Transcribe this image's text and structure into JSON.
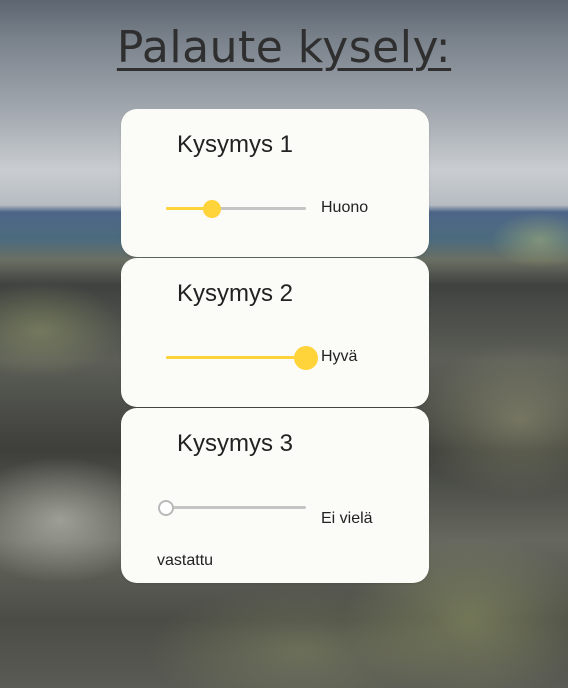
{
  "page": {
    "title": "Palaute kysely:"
  },
  "questions": [
    {
      "title": "Kysymys 1",
      "answer": "Huono",
      "slider_value": 0.33
    },
    {
      "title": "Kysymys 2",
      "answer": "Hyvä",
      "slider_value": 1.0
    },
    {
      "title": "Kysymys 3",
      "answer": "Ei vielä vastattu",
      "slider_value": 0.0
    }
  ],
  "colors": {
    "accent": "#ffd43b",
    "track": "#c4c4c4",
    "card": "#fbfbf7",
    "text": "#222222"
  }
}
